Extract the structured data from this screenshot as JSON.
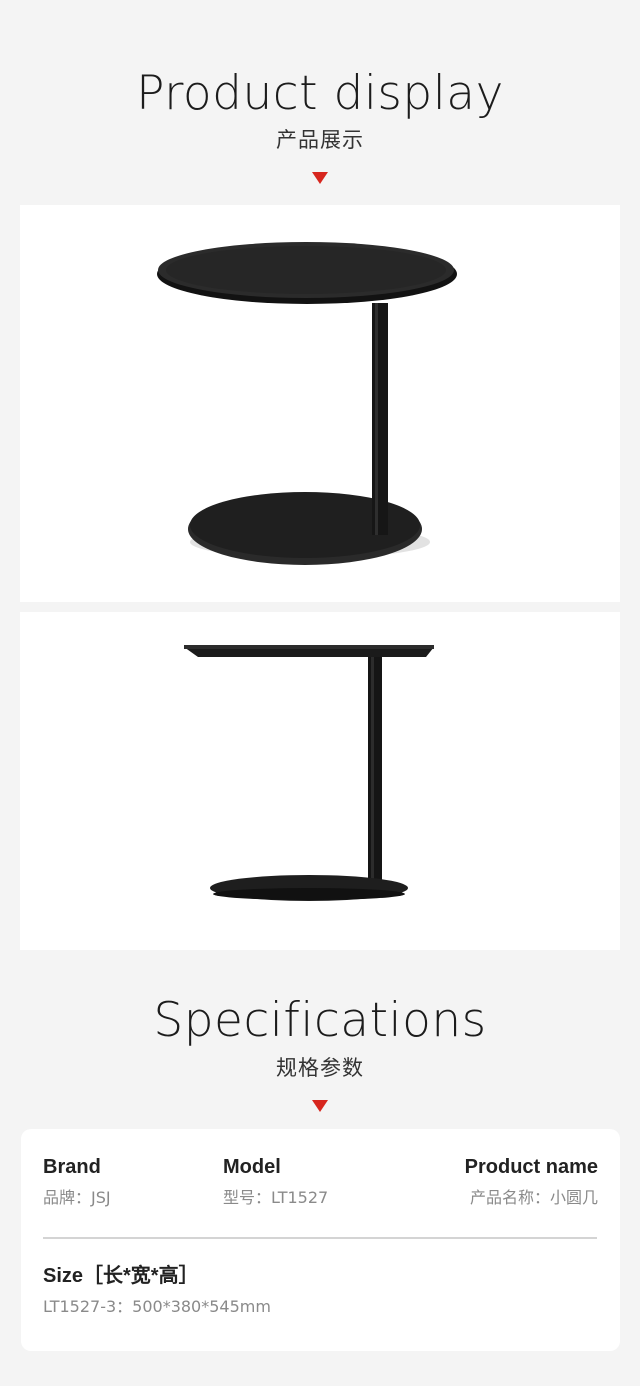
{
  "display": {
    "title": "Product display",
    "subtitle": "产品展示"
  },
  "specs": {
    "title": "Specifications",
    "subtitle": "规格参数",
    "brand": {
      "label": "Brand",
      "value": "品牌：JSJ"
    },
    "model": {
      "label": "Model",
      "value": "型号：LT1527"
    },
    "product_name": {
      "label": "Product name",
      "value": "产品名称：小圆几"
    },
    "size": {
      "label": "Size［长*宽*高］",
      "value": "LT1527-3：500*380*545mm"
    }
  },
  "colors": {
    "background": "#f4f4f4",
    "accent_triangle": "#d7261e",
    "card": "#ffffff",
    "table": "#1b1b1b"
  }
}
